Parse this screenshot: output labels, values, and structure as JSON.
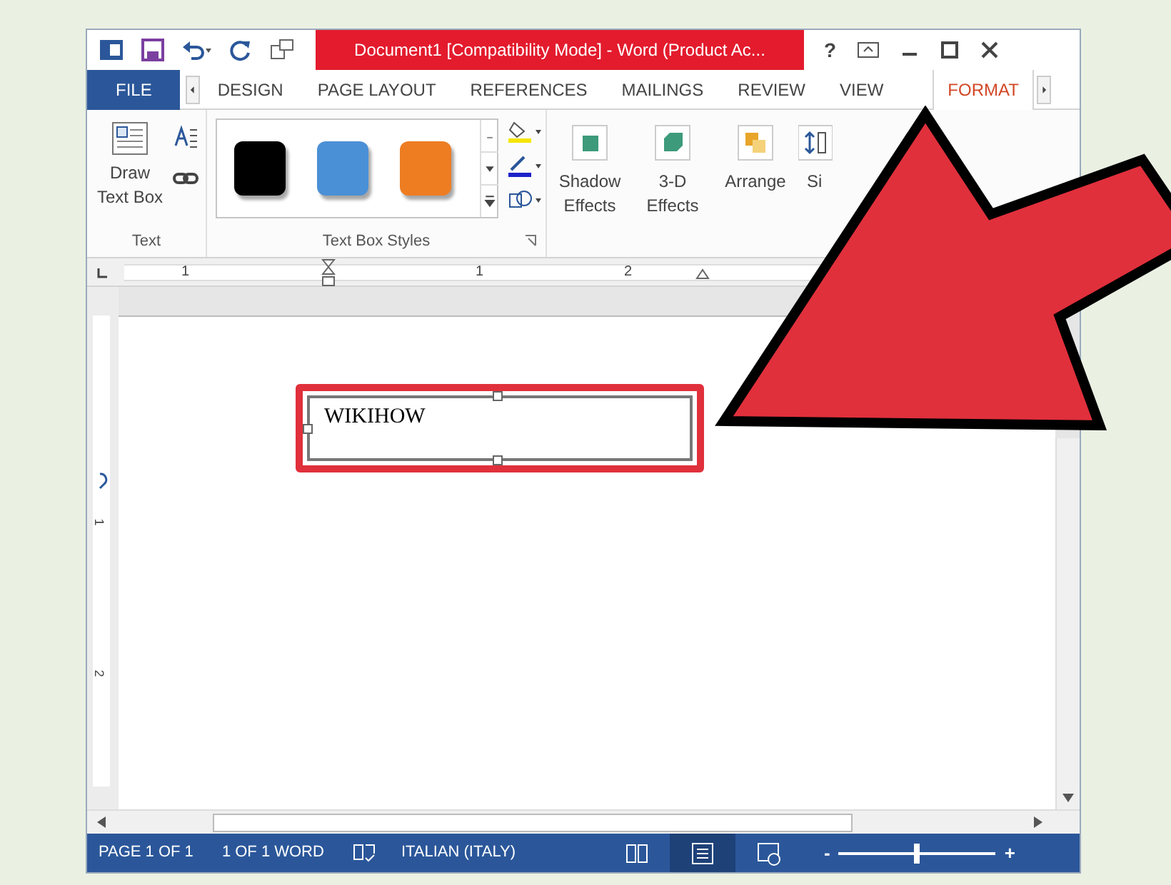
{
  "window": {
    "title": "Document1 [Compatibility Mode] -  Word (Product Ac..."
  },
  "title_controls": [
    "?"
  ],
  "tabs": [
    {
      "label": "FILE",
      "kind": "file",
      "selected": false
    },
    {
      "label": "DESIGN",
      "kind": "tab",
      "selected": false
    },
    {
      "label": "PAGE LAYOUT",
      "kind": "tab",
      "selected": false
    },
    {
      "label": "REFERENCES",
      "kind": "tab",
      "selected": false
    },
    {
      "label": "MAILINGS",
      "kind": "tab",
      "selected": false
    },
    {
      "label": "REVIEW",
      "kind": "tab",
      "selected": false
    },
    {
      "label": "VIEW",
      "kind": "tab",
      "selected": false
    },
    {
      "label": "FORMAT",
      "kind": "tab",
      "selected": true
    }
  ],
  "ribbon": {
    "text_group": {
      "button": "Draw Text Box",
      "label": "Text"
    },
    "styles_group": {
      "swatches": [
        {
          "color": "#000000"
        },
        {
          "color": "#4a90d6"
        },
        {
          "color": "#ee7d22"
        }
      ],
      "label": "Text Box Styles"
    },
    "buttons": [
      {
        "label": "Shadow Effects",
        "kind": "shadow"
      },
      {
        "label": "3-D Effects",
        "kind": "depth"
      },
      {
        "label": "Arrange",
        "kind": "arrange"
      },
      {
        "label": "Si",
        "kind": "size"
      }
    ]
  },
  "ruler": {
    "labels": [
      "1",
      "1",
      "2"
    ]
  },
  "vertical_ruler": {
    "labels": [
      "1",
      "2"
    ]
  },
  "document": {
    "text_box": {
      "text": "WIKIHOW",
      "highlighted": true
    }
  },
  "status_bar": {
    "page": "PAGE 1 OF 1",
    "words": "1 OF 1 WORD",
    "language": "ITALIAN (ITALY)",
    "views": [
      {
        "kind": "read",
        "selected": false
      },
      {
        "kind": "print",
        "selected": true
      },
      {
        "kind": "web",
        "selected": false
      }
    ],
    "zoom": {
      "minus": "-",
      "plus": "+",
      "level": 0.5
    }
  }
}
